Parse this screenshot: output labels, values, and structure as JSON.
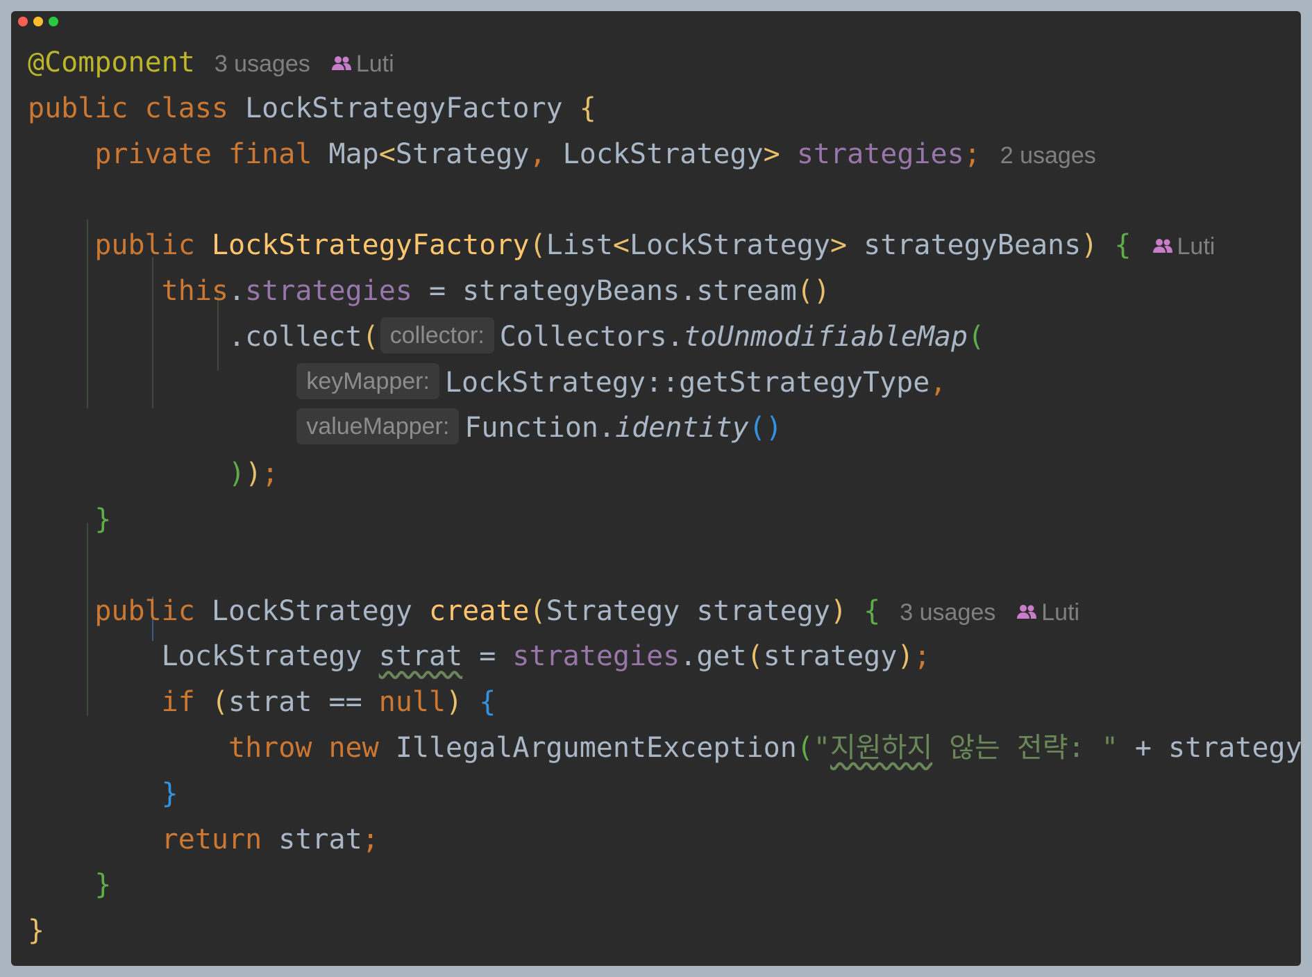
{
  "lines": [
    {
      "indent": 0,
      "tokens": [
        {
          "t": "@Component",
          "c": "ann"
        },
        {
          "t": "3 usages",
          "c": "lens"
        },
        {
          "t": "Luti",
          "c": "author"
        }
      ]
    },
    {
      "indent": 0,
      "tokens": [
        {
          "t": "public class ",
          "c": "kw"
        },
        {
          "t": "LockStrategyFactory "
        },
        {
          "t": "{",
          "c": "b1"
        }
      ]
    },
    {
      "indent": 1,
      "tokens": [
        {
          "t": "private final ",
          "c": "kw"
        },
        {
          "t": "Map"
        },
        {
          "t": "<",
          "c": "b1"
        },
        {
          "t": "Strategy"
        },
        {
          "t": ", ",
          "c": "p"
        },
        {
          "t": "LockStrategy"
        },
        {
          "t": ">",
          "c": "b1"
        },
        {
          "t": " "
        },
        {
          "t": "strategies",
          "c": "fld"
        },
        {
          "t": ";",
          "c": "p"
        },
        {
          "t": "2 usages",
          "c": "lens"
        }
      ]
    },
    {
      "indent": 0,
      "tokens": []
    },
    {
      "indent": 1,
      "tokens": [
        {
          "t": "public ",
          "c": "kw"
        },
        {
          "t": "LockStrategyFactory",
          "c": "fn"
        },
        {
          "t": "(",
          "c": "b1"
        },
        {
          "t": "List"
        },
        {
          "t": "<",
          "c": "b1"
        },
        {
          "t": "LockStrategy"
        },
        {
          "t": ">",
          "c": "b1"
        },
        {
          "t": " strategyBeans"
        },
        {
          "t": ")",
          "c": "b1"
        },
        {
          "t": " "
        },
        {
          "t": "{",
          "c": "b2"
        },
        {
          "t": "Luti",
          "c": "author"
        }
      ]
    },
    {
      "indent": 2,
      "tokens": [
        {
          "t": "this",
          "c": "kw"
        },
        {
          "t": "."
        },
        {
          "t": "strategies",
          "c": "fld"
        },
        {
          "t": " = strategyBeans.stream"
        },
        {
          "t": "()",
          "c": "b1"
        }
      ]
    },
    {
      "indent": 3,
      "tokens": [
        {
          "t": ".collect"
        },
        {
          "t": "(",
          "c": "b1"
        },
        {
          "t": "collector:",
          "c": "hint"
        },
        {
          "t": "Collectors."
        },
        {
          "t": "toUnmodifiableMap",
          "c": "it"
        },
        {
          "t": "(",
          "c": "b2"
        }
      ]
    },
    {
      "indent": 4,
      "tokens": [
        {
          "t": "keyMapper:",
          "c": "hint"
        },
        {
          "t": "LockStrategy::getStrategyType"
        },
        {
          "t": ",",
          "c": "p"
        }
      ]
    },
    {
      "indent": 4,
      "tokens": [
        {
          "t": "valueMapper:",
          "c": "hint"
        },
        {
          "t": "Function."
        },
        {
          "t": "identity",
          "c": "it"
        },
        {
          "t": "()",
          "c": "b3"
        }
      ]
    },
    {
      "indent": 3,
      "tokens": [
        {
          "t": ")",
          "c": "b2"
        },
        {
          "t": ")",
          "c": "b1"
        },
        {
          "t": ";",
          "c": "p"
        }
      ]
    },
    {
      "indent": 1,
      "tokens": [
        {
          "t": "}",
          "c": "b2"
        }
      ]
    },
    {
      "indent": 0,
      "tokens": []
    },
    {
      "indent": 1,
      "tokens": [
        {
          "t": "public ",
          "c": "kw"
        },
        {
          "t": "LockStrategy "
        },
        {
          "t": "create",
          "c": "fn"
        },
        {
          "t": "(",
          "c": "b1"
        },
        {
          "t": "Strategy strategy"
        },
        {
          "t": ")",
          "c": "b1"
        },
        {
          "t": " "
        },
        {
          "t": "{",
          "c": "b2"
        },
        {
          "t": "3 usages",
          "c": "lens"
        },
        {
          "t": "Luti",
          "c": "author"
        }
      ]
    },
    {
      "indent": 2,
      "tokens": [
        {
          "t": "LockStrategy "
        },
        {
          "t": "strat",
          "c": "wavy"
        },
        {
          "t": " = "
        },
        {
          "t": "strategies",
          "c": "fld"
        },
        {
          "t": ".get"
        },
        {
          "t": "(",
          "c": "b1"
        },
        {
          "t": "strategy"
        },
        {
          "t": ")",
          "c": "b1"
        },
        {
          "t": ";",
          "c": "p"
        }
      ]
    },
    {
      "indent": 2,
      "tokens": [
        {
          "t": "if ",
          "c": "kw"
        },
        {
          "t": "(",
          "c": "b1"
        },
        {
          "t": "strat == "
        },
        {
          "t": "null",
          "c": "kw"
        },
        {
          "t": ")",
          "c": "b1"
        },
        {
          "t": " "
        },
        {
          "t": "{",
          "c": "b3"
        }
      ]
    },
    {
      "indent": 3,
      "tokens": [
        {
          "t": "throw new ",
          "c": "kw"
        },
        {
          "t": "IllegalArgumentException"
        },
        {
          "t": "(",
          "c": "b2"
        },
        {
          "t": "\"",
          "c": "str"
        },
        {
          "t": "지원하지",
          "c": "str wavy"
        },
        {
          "t": " 않는 전략: \"",
          "c": "str"
        },
        {
          "t": " + strategy"
        },
        {
          "t": ")",
          "c": "b2"
        },
        {
          "t": ";",
          "c": "p"
        }
      ]
    },
    {
      "indent": 2,
      "tokens": [
        {
          "t": "}",
          "c": "b3"
        }
      ]
    },
    {
      "indent": 2,
      "tokens": [
        {
          "t": "return ",
          "c": "kw"
        },
        {
          "t": "strat"
        },
        {
          "t": ";",
          "c": "p"
        }
      ]
    },
    {
      "indent": 1,
      "tokens": [
        {
          "t": "}",
          "c": "b2"
        }
      ]
    },
    {
      "indent": 0,
      "tokens": [
        {
          "t": "}",
          "c": "b1"
        }
      ]
    }
  ]
}
